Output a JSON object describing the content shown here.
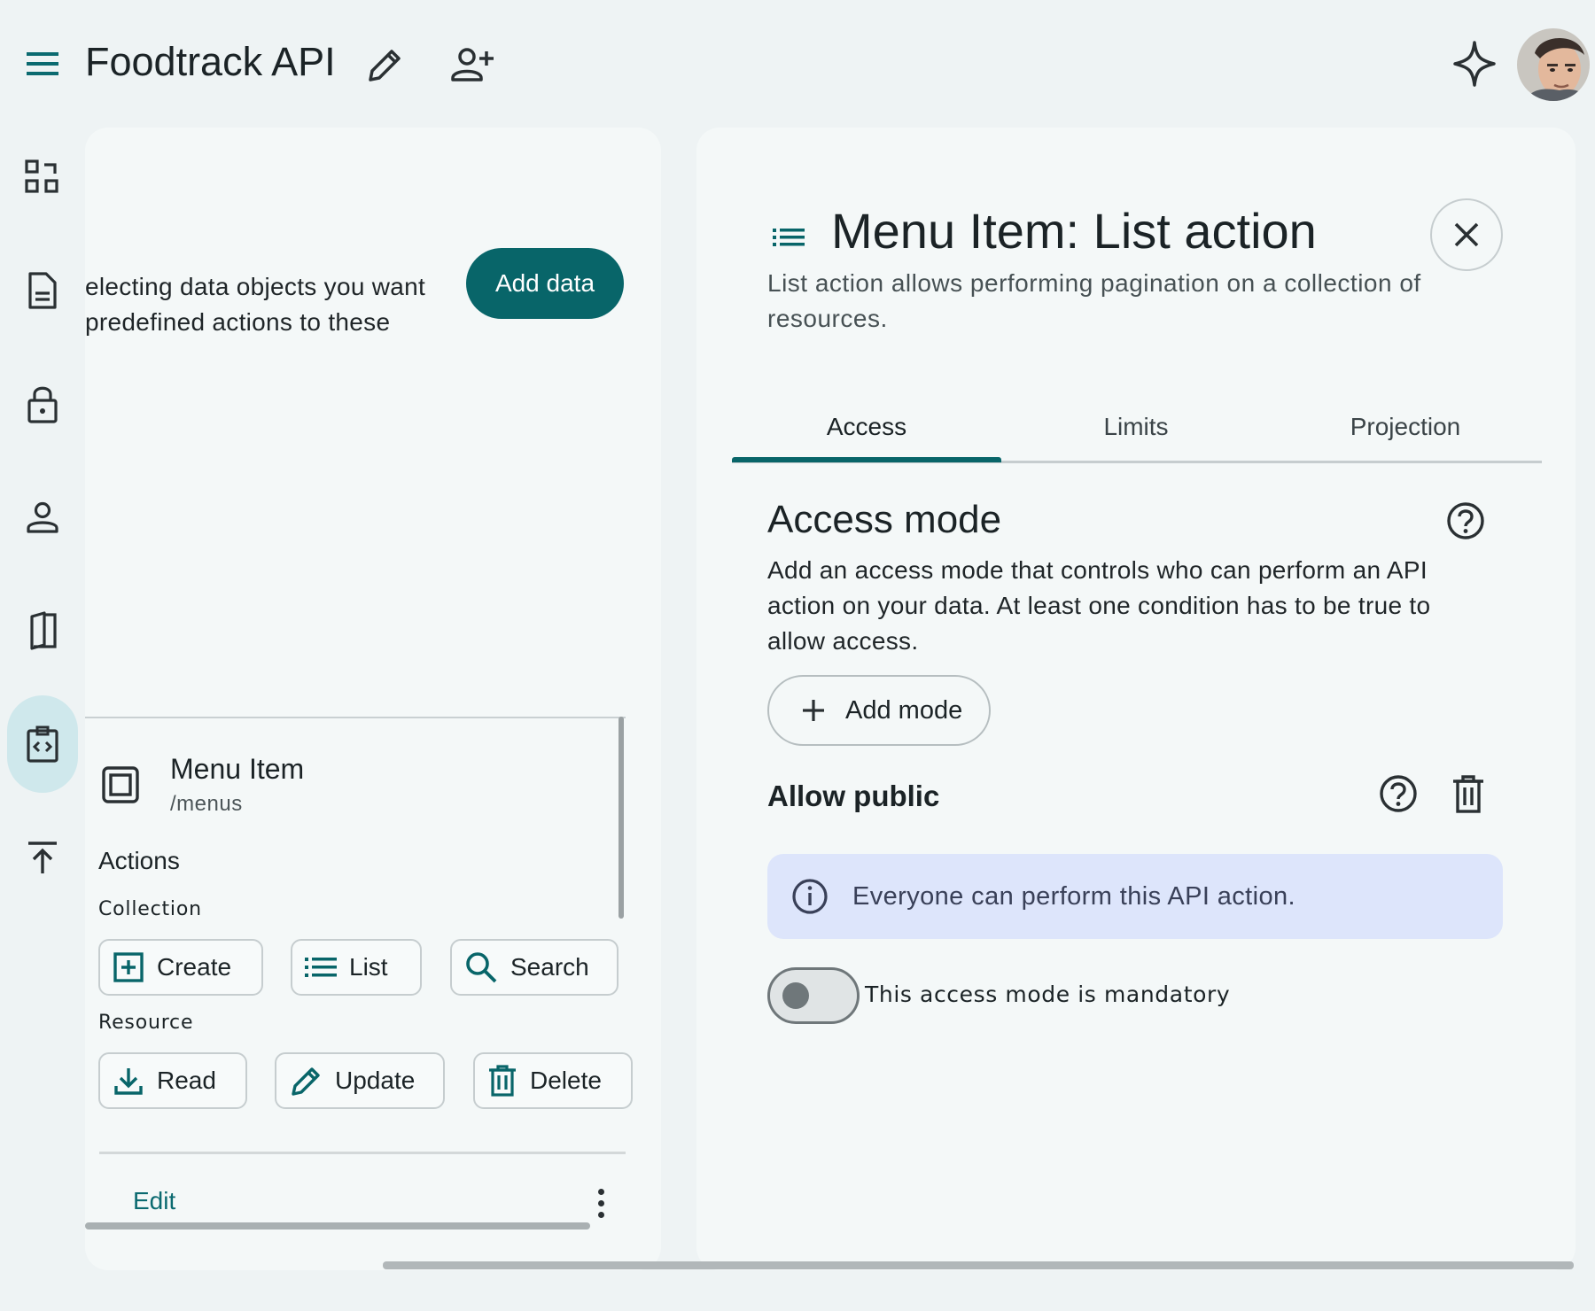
{
  "header": {
    "title": "Foodtrack API"
  },
  "left": {
    "intro_text": "electing data objects you want predefined actions to these",
    "add_data_label": "Add data",
    "resource": {
      "name": "Menu Item",
      "path": "/menus"
    },
    "actions_label": "Actions",
    "collection_label": "Collection",
    "collection_actions": [
      "Create",
      "List",
      "Search"
    ],
    "resource_label": "Resource",
    "resource_actions": [
      "Read",
      "Update",
      "Delete"
    ],
    "edit_label": "Edit"
  },
  "panel": {
    "title": "Menu Item: List action",
    "description": "List action allows performing pagination on a collection of resources.",
    "tabs": [
      "Access",
      "Limits",
      "Projection"
    ],
    "active_tab": "Access",
    "access_mode_title": "Access mode",
    "access_mode_desc": "Add an access mode that controls who can perform an API action on your data. At least one condition has to be true to allow access.",
    "add_mode_label": "Add mode",
    "allow_public_title": "Allow public",
    "info_text": "Everyone can perform this API action.",
    "toggle_label": "This access mode is mandatory",
    "toggle_on": false
  },
  "colors": {
    "accent": "#086569",
    "info_bg": "#dde5fb",
    "rail_active_bg": "#cfe8ec"
  },
  "icons": [
    "menu-icon",
    "pencil-icon",
    "add-user-icon",
    "sparkle-icon",
    "dashboard-icon",
    "document-icon",
    "lock-icon",
    "person-icon",
    "book-icon",
    "code-icon",
    "upload-icon",
    "list-icon",
    "close-icon",
    "help-icon",
    "trash-icon",
    "info-icon",
    "plus-icon",
    "download-icon",
    "search-icon"
  ]
}
